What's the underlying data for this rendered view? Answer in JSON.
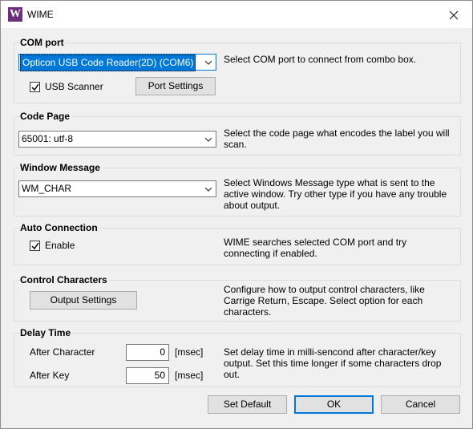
{
  "window": {
    "title": "WIME",
    "app_icon_glyph": "W"
  },
  "com_port": {
    "title": "COM port",
    "selected": "Opticon USB Code Reader(2D) (COM6)",
    "usb_scanner_label": "USB Scanner",
    "usb_scanner_checked": true,
    "port_settings_label": "Port Settings",
    "description": "Select COM port to connect from combo box."
  },
  "code_page": {
    "title": "Code Page",
    "selected": "65001: utf-8",
    "description": "Select the code page what encodes the label you will scan."
  },
  "window_message": {
    "title": "Window Message",
    "selected": "WM_CHAR",
    "description": "Select Windows Message type what is sent to the active window. Try other type if you have any trouble about output."
  },
  "auto_connection": {
    "title": "Auto Connection",
    "enable_label": "Enable",
    "enable_checked": true,
    "description": "WIME searches selected COM port and try connecting if enabled."
  },
  "control_characters": {
    "title": "Control Characters",
    "output_settings_label": "Output Settings",
    "description": "Configure how to output control characters, like Carrige Return, Escape. Select option for each characters."
  },
  "delay_time": {
    "title": "Delay Time",
    "after_character_label": "After Character",
    "after_character_value": "0",
    "after_key_label": "After Key",
    "after_key_value": "50",
    "unit": "[msec]",
    "description": "Set delay time in milli-sencond after character/key output. Set this time longer if some characters drop out."
  },
  "footer": {
    "set_default_label": "Set Default",
    "ok_label": "OK",
    "cancel_label": "Cancel"
  },
  "colors": {
    "accent": "#0078d7",
    "app_icon": "#6b2f7d",
    "dialog_bg": "#f0f0f0"
  }
}
